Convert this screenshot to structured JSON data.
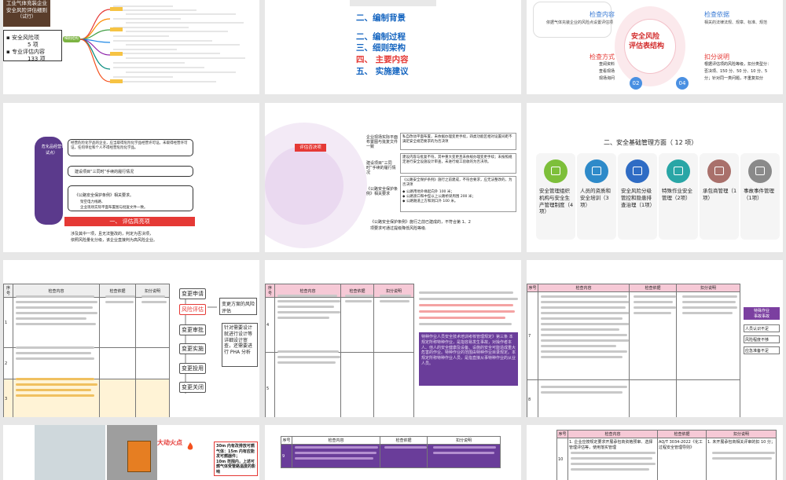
{
  "s1": {
    "title_lines": [
      "工业气体充装企业",
      "安全风险评估细则",
      "（试行）"
    ],
    "center_node": "细则结构",
    "bullets": [
      {
        "label": "安全风险项",
        "value": "5 项"
      },
      {
        "label": "专业评估内容",
        "value": "133 项"
      }
    ]
  },
  "s2": {
    "items": [
      "二、编制背景",
      "二、编制过程",
      "三、细则架构",
      "四、 主要内容",
      "五、 实施建议"
    ]
  },
  "s3": {
    "center": [
      "安全风险",
      "评估表结构"
    ],
    "q1_title": "检查内容",
    "q1_text": "依据气体充装企业的风险点设置评估项",
    "q2_title": "检查依据",
    "q2_text": "相关的法律法规、规章、标准、规范",
    "q3_title": "检查方式",
    "q3_lines": [
      "查阅资料",
      "查看现场",
      "现场询问"
    ],
    "q4_title": "扣分说明",
    "q4_lines": [
      "根据评估项的风险等级，扣分类型分：",
      "否决项、150 分、50 分、10 分、5",
      "分；针对同一类问题，不重复扣分"
    ],
    "num_a": "02",
    "num_b": "04"
  },
  "s4": {
    "side_labels": [
      "危化品经营许可（",
      "试点）"
    ],
    "box1": "经营危险化学品的企业，应当取得危险化学品经营许可证。未取得经营许可证，任何单位和个人不得经营危险化学品。",
    "box2": "建设项目“三同时”手续的履行情况",
    "box3": "《公路安全保护条例》相关要求。",
    "box3_lines": [
      "架空电力线路、",
      "企业现场实际平面布置图与批复文件一致。"
    ],
    "banner": "一、 评估高亮项",
    "foot": [
      "涉及其中一项，且无法整改的，判定为否决项，",
      "依照风险量化分级，该企业直接判为高风险企业。"
    ]
  },
  "s5": {
    "center_label": "评估否决项",
    "rows": [
      {
        "left": "企业现场实际平面布置图与批复文件一致",
        "right": "私自改动平面布置，未依据办理变更手续，四类功能区相对设置间距不满足安全规范要求的为否决项"
      },
      {
        "left": "建设项目“三同时”手续的履行情况",
        "right": "建设内容与批复不符，其中重大变更且未依规办理变更手续；未按照规定进行安全设施设计审查，未进行竣工验收的为否决项。"
      },
      {
        "left": "《公路安全保护条例》相关要求",
        "right": "《公路安全保护条例》施行之前建成，不符合要求，应无法整改的，为否决项"
      }
    ],
    "list": [
      "公路用地外缘起向外 100 米；",
      "公路渡口和中型以上公路桥梁周围 200 米；",
      "公路隧道上方和洞口外 100 米。"
    ],
    "foot": [
      "《公路安全保护条例》施行之前已建成的，不符合第 1、2",
      "项要求可通过提级降低风险等级."
    ]
  },
  "s6": {
    "title": "二、安全基础管理方面（ 12 项）",
    "cards": [
      {
        "label": "安全管理组织机构与安全生产管理制度（4项）",
        "color": "#7dbf3a"
      },
      {
        "label": "人员的资质和安全培训（3项）",
        "color": "#2e8ac9"
      },
      {
        "label": "安全风险分级管控和隐患排查治理（1项）",
        "color": "#2f6cc4"
      },
      {
        "label": "特殊作业安全管理（2项）",
        "color": "#29a6a6"
      },
      {
        "label": "承包商管理（1项）",
        "color": "#a9706b"
      },
      {
        "label": "事故事件管理（1项）",
        "color": "#8a8a8a"
      }
    ]
  },
  "s7": {
    "headers": [
      "序号",
      "检查内容",
      "检查依据",
      "扣分说明"
    ],
    "rows": [
      "1",
      "2",
      "3"
    ],
    "flow": [
      "变更申请",
      "风险评估",
      "变更审批",
      "变更实施",
      "变更投用",
      "变更关闭"
    ],
    "note": "变更方案的风险评估",
    "note2": "针对需要设计就进行设计等详细设计审查，还需要进行 PHA 分析"
  },
  "s8": {
    "headers": [
      "序号",
      "检查内容",
      "检查依据",
      "扣分说明"
    ],
    "rows": [
      "4",
      "5"
    ],
    "quote": "特种作业人员安全技术培训考核管理规定》第三条 本规定所称特种作业，是指容易发生事故，对操作者本人、他人的安全健康及设备、设施的安全可能造成重大危害的作业。特种作业的范围由特种作业目录规定。本规定所称特种作业人员，是指直接从事特种作业的从业人员。"
  },
  "s9": {
    "headers": [
      "序号",
      "检查内容",
      "检查依据",
      "扣分说明"
    ],
    "rows": [
      "7",
      "8"
    ],
    "side_title": [
      "特殊作业",
      "事故事故"
    ],
    "side_items": [
      "人员认识不足",
      "风险程度不够",
      "应急准备不足"
    ]
  },
  "s10": {
    "title": "大动火点",
    "notes": [
      "30m 内有改排放可燃气体：15m 内有应能发可燃器件；",
      "10m 范围内，上述可燃气体受管路温度的影响"
    ]
  },
  "s11": {
    "headers": [
      "序号",
      "检查内容",
      "检查依据",
      "扣分说明"
    ],
    "rows": [
      "9"
    ]
  },
  "s12": {
    "headers": [
      "序号",
      "检查内容",
      "检查依据",
      "扣分说明"
    ],
    "rows": [
      "10"
    ],
    "cell_a": "1. 企业应按规定要求开展承包商资格预审、选择管理评估等，使用落实管理",
    "cell_b": "AQ/T 3034-2022《化工过程安全管理导则》",
    "cell_c": "1. 未开展承包商相关评审的扣 10 分；"
  }
}
